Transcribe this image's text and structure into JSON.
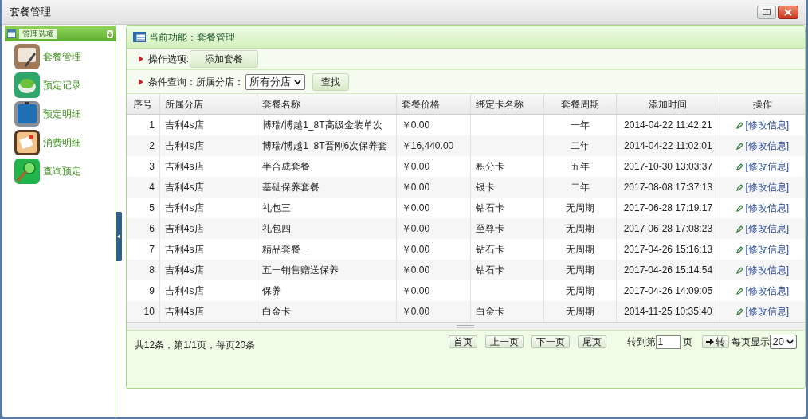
{
  "window": {
    "title": "套餐管理"
  },
  "sidebar": {
    "title": "管理选项",
    "items": [
      {
        "label": "套餐管理"
      },
      {
        "label": "预定记录"
      },
      {
        "label": "预定明细"
      },
      {
        "label": "消费明细"
      },
      {
        "label": "查询预定"
      }
    ]
  },
  "main": {
    "current_function": "当前功能：套餐管理",
    "operations": {
      "label": "操作选项:",
      "button": "添加套餐"
    },
    "filter": {
      "label": "条件查询：所属分店：",
      "select": "所有分店",
      "button": "查找"
    },
    "table": {
      "columns": [
        "序号",
        "所属分店",
        "套餐名称",
        "套餐价格",
        "绑定卡名称",
        "套餐周期",
        "添加时间",
        "操作"
      ],
      "rows": [
        [
          "1",
          "吉利4s店",
          "博瑞/博越1_8T高级金装单次",
          "￥0.00",
          "",
          "一年",
          "2014-04-22 11:42:21",
          "[修改信息]"
        ],
        [
          "2",
          "吉利4s店",
          "博瑞/博越1_8T晋刚6次保养套",
          "￥16,440.00",
          "",
          "二年",
          "2014-04-22 11:02:01",
          "[修改信息]"
        ],
        [
          "3",
          "吉利4s店",
          "半合成套餐",
          "￥0.00",
          "积分卡",
          "五年",
          "2017-10-30 13:03:37",
          "[修改信息]"
        ],
        [
          "4",
          "吉利4s店",
          "基础保养套餐",
          "￥0.00",
          "银卡",
          "二年",
          "2017-08-08 17:37:13",
          "[修改信息]"
        ],
        [
          "5",
          "吉利4s店",
          "礼包三",
          "￥0.00",
          "钻石卡",
          "无周期",
          "2017-06-28 17:19:17",
          "[修改信息]"
        ],
        [
          "6",
          "吉利4s店",
          "礼包四",
          "￥0.00",
          "至尊卡",
          "无周期",
          "2017-06-28 17:08:23",
          "[修改信息]"
        ],
        [
          "7",
          "吉利4s店",
          "精品套餐一",
          "￥0.00",
          "钻石卡",
          "无周期",
          "2017-04-26 15:16:13",
          "[修改信息]"
        ],
        [
          "8",
          "吉利4s店",
          "五一销售赠送保养",
          "￥0.00",
          "钻石卡",
          "无周期",
          "2017-04-26 15:14:54",
          "[修改信息]"
        ],
        [
          "9",
          "吉利4s店",
          "保养",
          "￥0.00",
          "",
          "无周期",
          "2017-04-26 14:09:05",
          "[修改信息]"
        ],
        [
          "10",
          "吉利4s店",
          "白金卡",
          "￥0.00",
          "白金卡",
          "无周期",
          "2014-11-25 10:35:40",
          "[修改信息]"
        ]
      ]
    },
    "footer": {
      "summary": "共12条，第1/1页，每页20条",
      "pager": [
        "首页",
        "上一页",
        "下一页",
        "尾页"
      ],
      "goto_label": "转到第",
      "goto_value": "1",
      "page_label": "页",
      "go_button": "转",
      "per_page_label": "每页显示",
      "per_page": "20"
    }
  }
}
